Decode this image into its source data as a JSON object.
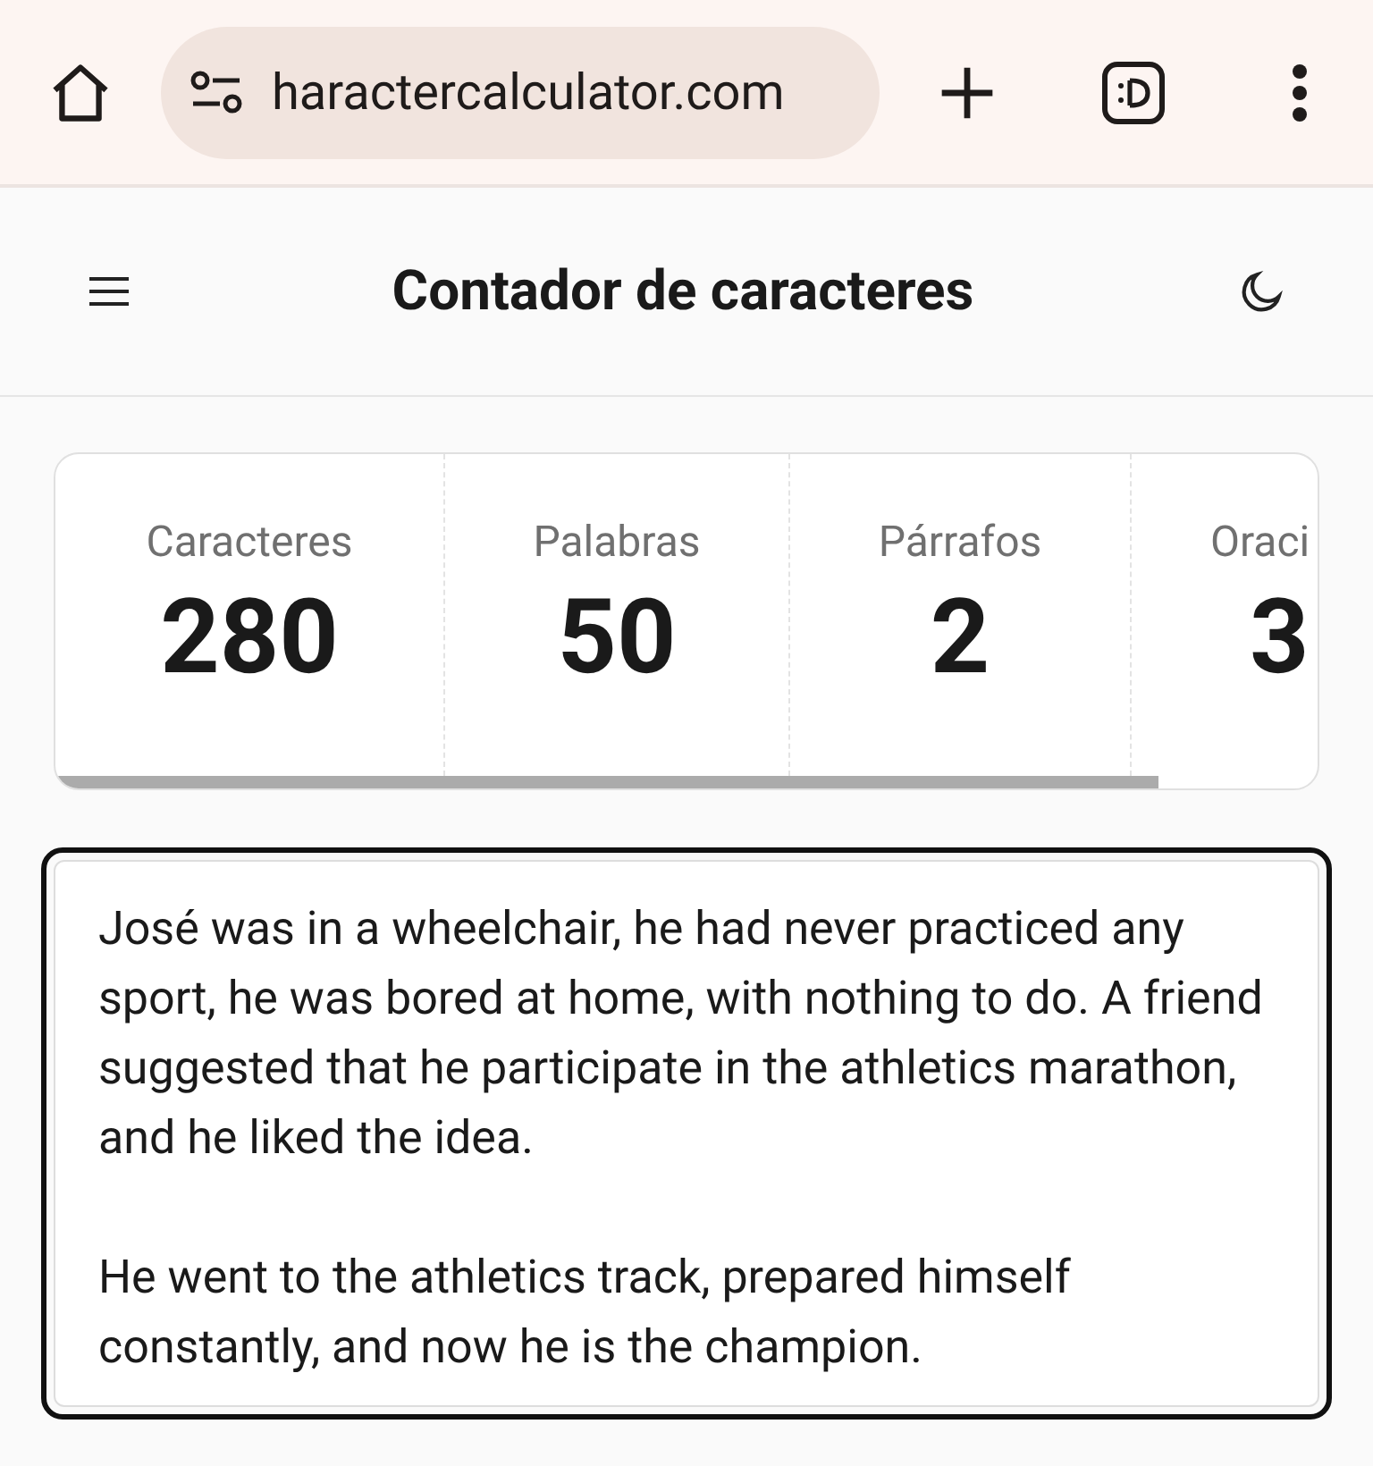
{
  "browser": {
    "url": "haractercalculator.com"
  },
  "header": {
    "title": "Contador de caracteres"
  },
  "stats": [
    {
      "label": "Caracteres",
      "value": "280"
    },
    {
      "label": "Palabras",
      "value": "50"
    },
    {
      "label": "Párrafos",
      "value": "2"
    },
    {
      "label": "Oraci",
      "value": "3"
    }
  ],
  "editor": {
    "value": "José was in a wheelchair, he had never practiced any sport, he was bored at home, with nothing to do. A friend suggested that he participate in the athletics marathon, and he liked the idea.\n\nHe went to the athletics track, prepared himself constantly, and now he is the champion."
  }
}
